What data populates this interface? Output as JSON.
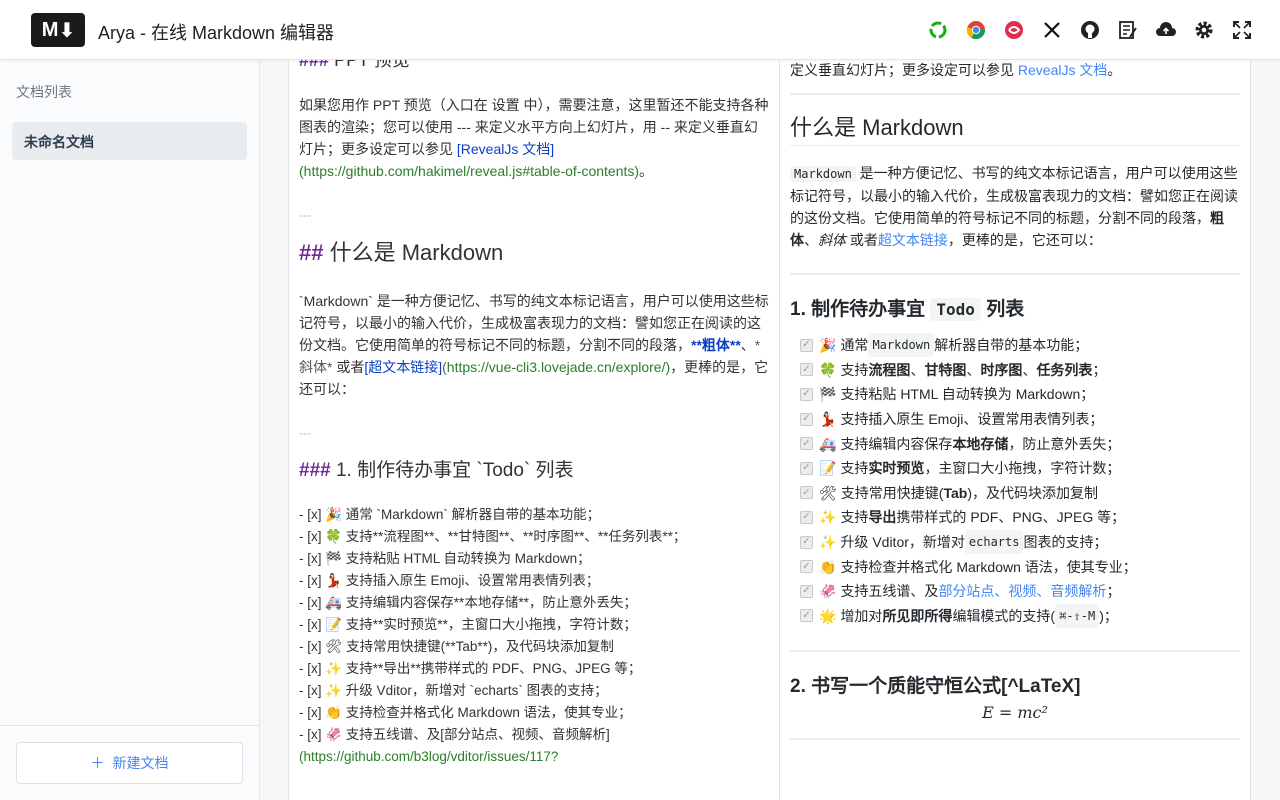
{
  "app": {
    "title": "Arya - 在线 Markdown 编辑器",
    "logo_text": "M",
    "accent_color": "#4285f4"
  },
  "toolbar": {
    "icons": [
      "share-icon",
      "chrome-icon",
      "sync-icon",
      "x-icon",
      "github-icon",
      "edit-doc-icon",
      "cloud-upload-icon",
      "gear-icon",
      "fullscreen-icon"
    ]
  },
  "sidebar": {
    "title": "文档列表",
    "documents": [
      {
        "label": "未命名文档"
      }
    ],
    "new_doc_label": "新建文档"
  },
  "editor": {
    "top_heading_mk": "###",
    "top_heading_text": "PPT 预览",
    "ppt_para_1": "如果您用作 PPT 预览（入口在 设置 中），需要注意，这里暂还不能支持各种图表的渲染；您可以使用 --- 来定义水平方向上幻灯片，用 -- 来定义垂直幻灯片；更多设定可以参见 ",
    "ppt_link_text": "[RevealJs 文档]",
    "ppt_link_url": "(https://github.com/hakimel/reveal.js#table-of-contents)",
    "ppt_end": "。",
    "hr": "---",
    "h2_mk": "##",
    "h2_text": "什么是 Markdown",
    "md_para_1": "`Markdown` 是一种方便记忆、书写的纯文本标记语言，用户可以使用这些标记符号，以最小的输入代价，生成极富表现力的文档：譬如您正在阅读的这份文档。它使用简单的符号标记不同的标题，分割不同的段落，",
    "md_bold": "**粗体**",
    "md_sep": "、",
    "md_em": "*斜体*",
    "md_or": " 或者",
    "md_link_text": "[超文本链接]",
    "md_link_url": "(https://vue-cli3.lovejade.cn/explore/)",
    "md_end": "，更棒的是，它还可以：",
    "todo_mk": "###",
    "todo_text": "1. 制作待办事宜 `Todo` 列表",
    "tasks": [
      "- [x] 🎉 通常 `Markdown` 解析器自带的基本功能；",
      "- [x] 🍀 支持**流程图**、**甘特图**、**时序图**、**任务列表**；",
      "- [x] 🏁 支持粘贴 HTML 自动转换为 Markdown；",
      "- [x] 💃🏻 支持插入原生 Emoji、设置常用表情列表；",
      "- [x] 🚑 支持编辑内容保存**本地存储**，防止意外丢失；",
      "- [x] 📝 支持**实时预览**，主窗口大小拖拽，字符计数；",
      "- [x] 🛠 支持常用快捷键(**Tab**)，及代码块添加复制",
      "- [x] ✨ 支持**导出**携带样式的 PDF、PNG、JPEG 等；",
      "- [x] ✨ 升级 Vditor，新增对 `echarts` 图表的支持；",
      "- [x] 👏 支持检查并格式化 Markdown 语法，使其专业；",
      "- [x] 🦑 支持五线谱、及[部分站点、视频、音频解析]"
    ],
    "last_url": "(https://github.com/b3log/vditor/issues/117?"
  },
  "preview": {
    "top_text": "定义垂直幻灯片；更多设定可以参见 ",
    "top_link": "RevealJs 文档",
    "top_end": "。",
    "h2": "什么是 Markdown",
    "md_code": "Markdown",
    "md_para": " 是一种方便记忆、书写的纯文本标记语言，用户可以使用这些标记符号，以最小的输入代价，生成极富表现力的文档：譬如您正在阅读的这份文档。它使用简单的符号标记不同的标题，分割不同的段落，",
    "md_bold": "粗体",
    "md_sep": "、",
    "md_em": "斜体",
    "md_or": " 或者",
    "md_link": "超文本链接",
    "md_end": "，更棒的是，它还可以：",
    "todo_h3_a": "1. 制作待办事宜 ",
    "todo_h3_code": "Todo",
    "todo_h3_b": " 列表",
    "tasks": [
      {
        "emoji": "🎉",
        "parts": [
          "通常 ",
          "Markdown",
          " 解析器自带的基本功能；"
        ],
        "styles": [
          "",
          "code",
          ""
        ]
      },
      {
        "emoji": "🍀",
        "parts": [
          "支持",
          "流程图",
          "、",
          "甘特图",
          "、",
          "时序图",
          "、",
          "任务列表",
          "；"
        ],
        "styles": [
          "",
          "b",
          "",
          "b",
          "",
          "b",
          "",
          "b",
          ""
        ]
      },
      {
        "emoji": "🏁",
        "parts": [
          "支持粘贴 HTML 自动转换为 Markdown；"
        ],
        "styles": [
          ""
        ]
      },
      {
        "emoji": "💃🏻",
        "parts": [
          "支持插入原生 Emoji、设置常用表情列表；"
        ],
        "styles": [
          ""
        ]
      },
      {
        "emoji": "🚑",
        "parts": [
          "支持编辑内容保存",
          "本地存储",
          "，防止意外丢失；"
        ],
        "styles": [
          "",
          "b",
          ""
        ]
      },
      {
        "emoji": "📝",
        "parts": [
          "支持",
          "实时预览",
          "，主窗口大小拖拽，字符计数；"
        ],
        "styles": [
          "",
          "b",
          ""
        ]
      },
      {
        "emoji": "🛠",
        "parts": [
          "支持常用快捷键(",
          "Tab",
          ")，及代码块添加复制"
        ],
        "styles": [
          "",
          "b",
          ""
        ]
      },
      {
        "emoji": "✨",
        "parts": [
          "支持",
          "导出",
          "携带样式的 PDF、PNG、JPEG 等；"
        ],
        "styles": [
          "",
          "b",
          ""
        ]
      },
      {
        "emoji": "✨",
        "parts": [
          "升级 Vditor，新增对 ",
          "echarts",
          " 图表的支持；"
        ],
        "styles": [
          "",
          "code",
          ""
        ]
      },
      {
        "emoji": "👏",
        "parts": [
          "支持检查并格式化 Markdown 语法，使其专业；"
        ],
        "styles": [
          ""
        ]
      },
      {
        "emoji": "🦑",
        "parts": [
          "支持五线谱、及",
          "部分站点、视频、音频解析",
          "；"
        ],
        "styles": [
          "",
          "link",
          ""
        ]
      },
      {
        "emoji": "🌟",
        "parts": [
          "增加对",
          "所见即所得",
          "编辑模式的支持(",
          "⌘-⇧-M",
          ")；"
        ],
        "styles": [
          "",
          "b",
          "",
          "code",
          ""
        ]
      }
    ],
    "latex_h3": "2. 书写一个质能守恒公式[^LaTeX]",
    "formula": "E = mc²"
  }
}
